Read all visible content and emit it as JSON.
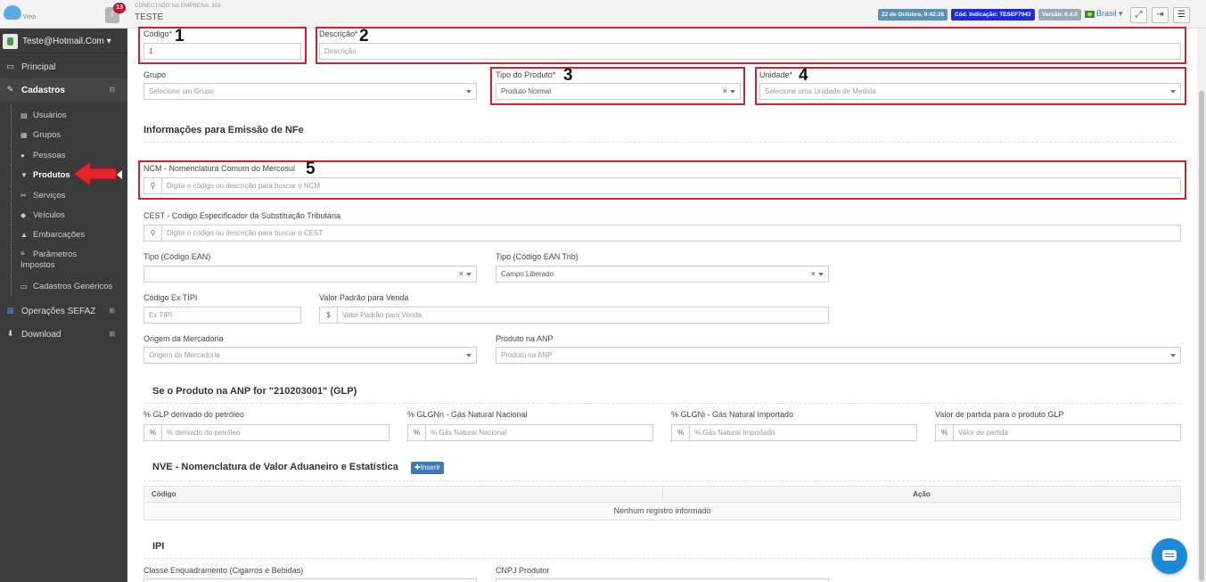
{
  "header": {
    "logo_text": "Web",
    "notification_count": "13",
    "company_label": "CONECTADO NA EMPRESA: 398",
    "company_name": "TESTE",
    "date_badge": "22 de Outubro, 9:42:26",
    "code_badge": "Cód. Indicação: TESEF7943",
    "version_badge": "Versão: 6.4.0",
    "language": "Brasil"
  },
  "sidebar": {
    "user": "Teste@Hotmail.Com",
    "items": [
      {
        "label": "Principal"
      },
      {
        "label": "Cadastros"
      },
      {
        "label": "Operações SEFAZ"
      },
      {
        "label": "Download"
      }
    ],
    "subitems": [
      {
        "label": "Usuários"
      },
      {
        "label": "Grupos"
      },
      {
        "label": "Pessoas"
      },
      {
        "label": "Produtos"
      },
      {
        "label": "Serviços"
      },
      {
        "label": "Veículos"
      },
      {
        "label": "Embarcações"
      },
      {
        "label": "Parâmetros Impostos"
      },
      {
        "label": "Cadastros Genéricos"
      }
    ]
  },
  "form": {
    "codigo_label": "Código*",
    "codigo_value": "1",
    "descricao_label": "Descrição*",
    "descricao_placeholder": "Descrição",
    "grupo_label": "Grupo",
    "grupo_placeholder": "Selecione um Grupo",
    "tipo_label": "Tipo do Produto*",
    "tipo_value": "Produto Normal",
    "unidade_label": "Unidade*",
    "unidade_placeholder": "Selecione uma Unidade de Medida",
    "nfe_section": "Informações para Emissão de NFe",
    "ncm_label": "NCM - Nomenclatura Comum do Mercosul",
    "ncm_placeholder": "Digite o código ou descrição para buscar o NCM",
    "cest_label": "CEST - Código Especificador da Substituição Tributária",
    "cest_placeholder": "Digite o código ou descrição para buscar o CEST",
    "ean_label": "Tipo (Código EAN)",
    "ean_trib_label": "Tipo (Código EAN Trib)",
    "ean_trib_value": "Campo Liberado",
    "extipi_label": "Código Ex TIPI",
    "extipi_placeholder": "Ex TIPI",
    "valor_label": "Valor Padrão para Venda",
    "valor_addon": "$",
    "valor_placeholder": "Valor Padrão para Venda",
    "origem_label": "Origem da Mercadoria",
    "origem_placeholder": "Origem da Mercadoria",
    "anp_label": "Produto na ANP",
    "anp_placeholder": "Produto na ANP",
    "glp_section": "Se o Produto na ANP for \"210203001\" (GLP)",
    "glp_label": "% GLP derivado do petróleo",
    "glp_placeholder": "% derivado do petróleo",
    "glgnn_label": "% GLGNn - Gás Natural Nacional",
    "glgnn_placeholder": "% Gás Natural Nacional",
    "glgni_label": "% GLGNi - Gás Natural Importado",
    "glgni_placeholder": "% Gás Natural Importado",
    "partida_label": "Valor de partida para o produto GLP",
    "partida_placeholder": "Valor de partida",
    "pct": "%",
    "nve_section": "NVE - Nomenclatura de Valor Aduaneiro e Estatística",
    "insert_button": "Inserir",
    "col_codigo": "Código",
    "col_acao": "Ação",
    "empty_row": "Nenhum registro informado",
    "ipi_section": "IPI",
    "classe_label": "Classe Enquadramento (Cigarros e Bebidas)",
    "cnpj_label": "CNPJ Produtor"
  },
  "annotations": [
    "1",
    "2",
    "3",
    "4",
    "5"
  ],
  "colors": {
    "annotation_red": "#d3202d",
    "sidebar_bg": "#3b3b3b",
    "accent_blue": "#3c78b5"
  }
}
